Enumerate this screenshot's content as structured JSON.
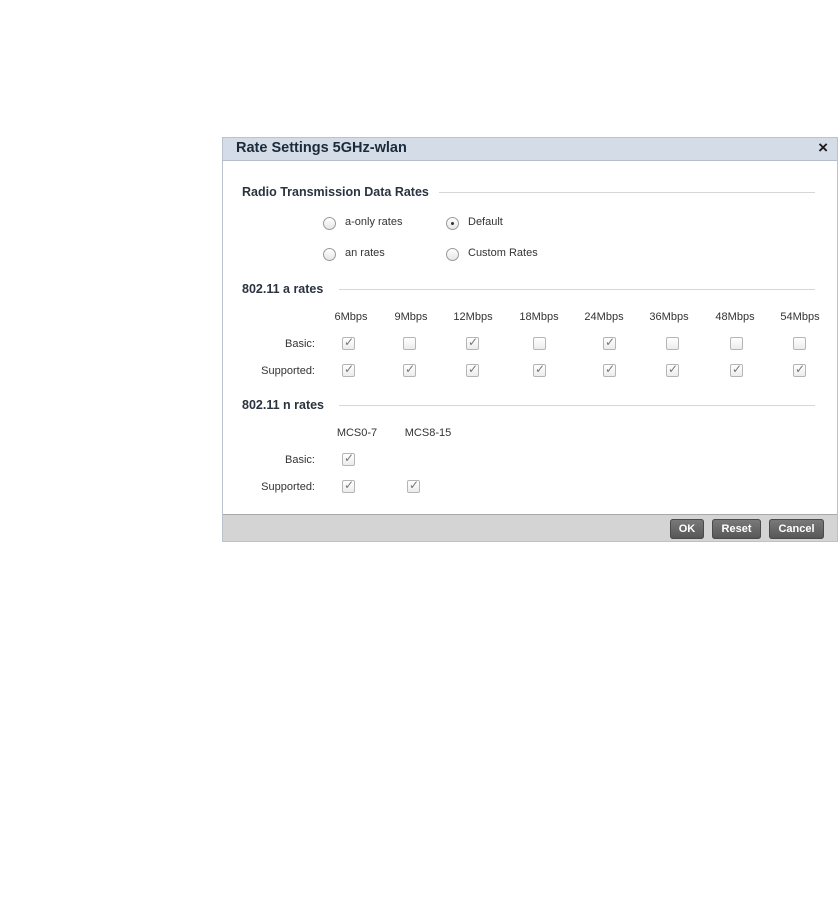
{
  "dialog": {
    "title": "Rate Settings 5GHz-wlan",
    "close_label": "×"
  },
  "radio_section": {
    "title": "Radio Transmission Data Rates",
    "options": [
      {
        "label": "a-only rates",
        "checked": false
      },
      {
        "label": "Default",
        "checked": true
      },
      {
        "label": "an rates",
        "checked": false
      },
      {
        "label": "Custom Rates",
        "checked": false
      }
    ]
  },
  "a_rates": {
    "title": "802.11 a rates",
    "columns": [
      "6Mbps",
      "9Mbps",
      "12Mbps",
      "18Mbps",
      "24Mbps",
      "36Mbps",
      "48Mbps",
      "54Mbps"
    ],
    "rows": [
      {
        "label": "Basic:",
        "checked": [
          true,
          false,
          true,
          false,
          true,
          false,
          false,
          false
        ]
      },
      {
        "label": "Supported:",
        "checked": [
          true,
          true,
          true,
          true,
          true,
          true,
          true,
          true
        ]
      }
    ]
  },
  "n_rates": {
    "title": "802.11 n rates",
    "columns": [
      "MCS0-7",
      "MCS8-15"
    ],
    "rows": [
      {
        "label": "Basic:",
        "checked": [
          true,
          null
        ]
      },
      {
        "label": "Supported:",
        "checked": [
          true,
          true
        ]
      }
    ]
  },
  "buttons": {
    "ok": "OK",
    "reset": "Reset",
    "cancel": "Cancel"
  }
}
